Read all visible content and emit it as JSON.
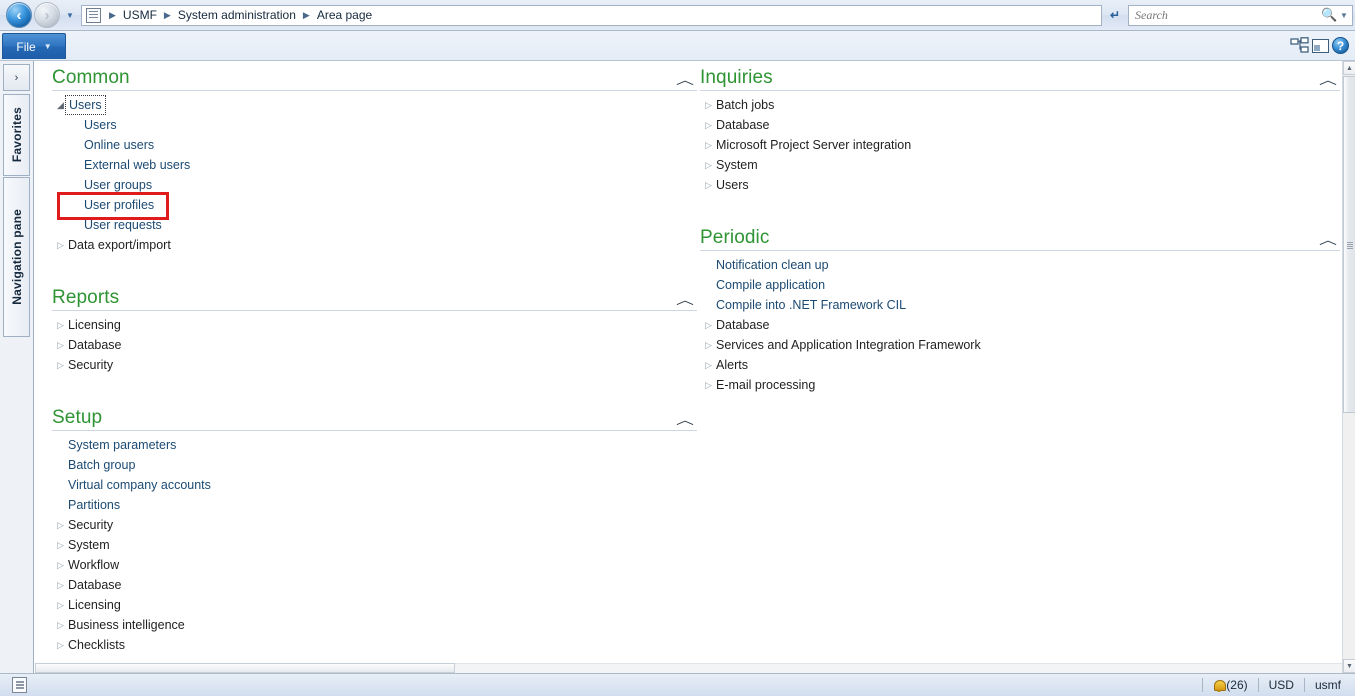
{
  "addressbar": {
    "back_icon": "back-arrow-icon",
    "forward_icon": "forward-arrow-icon",
    "history_caret": "▼",
    "breadcrumb_icon": "list-page-icon",
    "breadcrumbs": [
      "USMF",
      "System administration",
      "Area page"
    ],
    "separator": "▶",
    "refresh_label": "↵",
    "search": {
      "placeholder": "Search",
      "value": "",
      "search_icon": "magnifier-icon",
      "dropdown_caret": "▼"
    }
  },
  "ribbon": {
    "file_tab_label": "File",
    "file_tab_caret": "▼",
    "related_info_icon": "related-information-icon",
    "pane_layout_icon": "pane-layout-icon",
    "help_icon": "help-icon",
    "help_glyph": "?"
  },
  "left_strip": {
    "expand_button_glyph": "›",
    "tabs": [
      {
        "label": "Favorites",
        "name": "tab-favorites"
      },
      {
        "label": "Navigation pane",
        "name": "tab-navigation-pane"
      }
    ]
  },
  "colors": {
    "section_heading_green": "#2e9434",
    "link_blue": "#1c4a72",
    "highlight_red": "#e01b1b",
    "file_tab_blue": "#2569b5"
  },
  "collapse_glyph": "︿",
  "arrow_collapsed": "▷",
  "arrow_expanded": "◢",
  "sections": {
    "common": {
      "title": "Common",
      "items": [
        {
          "label": "Users",
          "type": "group",
          "expanded": true,
          "focused": true
        },
        {
          "label": "Users",
          "type": "child"
        },
        {
          "label": "Online users",
          "type": "child"
        },
        {
          "label": "External web users",
          "type": "child"
        },
        {
          "label": "User groups",
          "type": "child"
        },
        {
          "label": "User profiles",
          "type": "child",
          "highlighted": true
        },
        {
          "label": "User requests",
          "type": "child"
        },
        {
          "label": "Data export/import",
          "type": "group",
          "expanded": false
        }
      ]
    },
    "reports": {
      "title": "Reports",
      "items": [
        {
          "label": "Licensing",
          "type": "group",
          "expanded": false
        },
        {
          "label": "Database",
          "type": "group",
          "expanded": false
        },
        {
          "label": "Security",
          "type": "group",
          "expanded": false
        }
      ]
    },
    "setup": {
      "title": "Setup",
      "items": [
        {
          "label": "System parameters",
          "type": "leaf"
        },
        {
          "label": "Batch group",
          "type": "leaf"
        },
        {
          "label": "Virtual company accounts",
          "type": "leaf"
        },
        {
          "label": "Partitions",
          "type": "leaf"
        },
        {
          "label": "Security",
          "type": "group",
          "expanded": false
        },
        {
          "label": "System",
          "type": "group",
          "expanded": false
        },
        {
          "label": "Workflow",
          "type": "group",
          "expanded": false
        },
        {
          "label": "Database",
          "type": "group",
          "expanded": false
        },
        {
          "label": "Licensing",
          "type": "group",
          "expanded": false
        },
        {
          "label": "Business intelligence",
          "type": "group",
          "expanded": false
        },
        {
          "label": "Checklists",
          "type": "group",
          "expanded": false
        }
      ]
    },
    "inquiries": {
      "title": "Inquiries",
      "items": [
        {
          "label": "Batch jobs",
          "type": "group",
          "expanded": false
        },
        {
          "label": "Database",
          "type": "group",
          "expanded": false
        },
        {
          "label": "Microsoft Project Server integration",
          "type": "group",
          "expanded": false
        },
        {
          "label": "System",
          "type": "group",
          "expanded": false
        },
        {
          "label": "Users",
          "type": "group",
          "expanded": false
        }
      ]
    },
    "periodic": {
      "title": "Periodic",
      "items": [
        {
          "label": "Notification clean up",
          "type": "leaf"
        },
        {
          "label": "Compile application",
          "type": "leaf"
        },
        {
          "label": "Compile into .NET Framework CIL",
          "type": "leaf"
        },
        {
          "label": "Database",
          "type": "group",
          "expanded": false
        },
        {
          "label": "Services and Application Integration Framework",
          "type": "group",
          "expanded": false
        },
        {
          "label": "Alerts",
          "type": "group",
          "expanded": false
        },
        {
          "label": "E-mail processing",
          "type": "group",
          "expanded": false
        }
      ]
    }
  },
  "statusbar": {
    "doc_icon": "document-status-icon",
    "bell_icon": "alerts-bell-icon",
    "alerts_count": "(26)",
    "currency": "USD",
    "company": "usmf"
  }
}
